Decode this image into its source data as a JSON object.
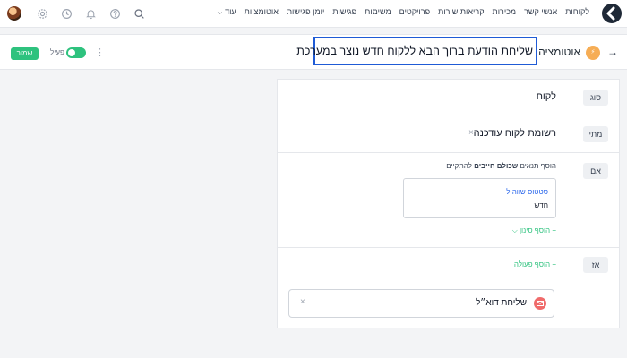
{
  "nav": {
    "items": [
      "לקוחות",
      "אנשי קשר",
      "מכירות",
      "קריאות שירות",
      "פרויקטים",
      "משימות",
      "פגישות",
      "יומן פגישות",
      "אוטומציות"
    ],
    "more": "עוד"
  },
  "header": {
    "breadcrumb": "אוטומציה",
    "badge": "⚡",
    "title": "שליחת הודעת ברוך הבא ללקוח חדש נוצר במערכת",
    "active_label": "פעיל",
    "active": true,
    "save_label": "שמור"
  },
  "rows": {
    "type": {
      "tag": "סוג",
      "value": "לקוח"
    },
    "when": {
      "tag": "מתי",
      "value": "רשומת לקוח עודכנה"
    },
    "if": {
      "tag": "אם",
      "title_pre": "הוסף תנאים ",
      "title_bold": "שכולם חייבים",
      "title_post": " להתקיים",
      "condition_field": "סטטוס שווה ל",
      "condition_value": "חדש",
      "add_filter_label": "+ הוסף סינון ⌵"
    },
    "then": {
      "tag": "אז",
      "add_action_label": "+ הוסף פעולה",
      "action_label": "שליחת דוא״ל"
    }
  },
  "colors": {
    "accent": "#2ec27e",
    "highlight": "#1f5bd6",
    "link": "#2563eb",
    "mail": "#f06b6b"
  },
  "icons": [
    "logo-icon",
    "search-icon",
    "help-icon",
    "bell-icon",
    "clock-icon",
    "gear-icon",
    "avatar",
    "back-arrow-icon",
    "kebab-icon",
    "close-icon",
    "mail-icon"
  ]
}
